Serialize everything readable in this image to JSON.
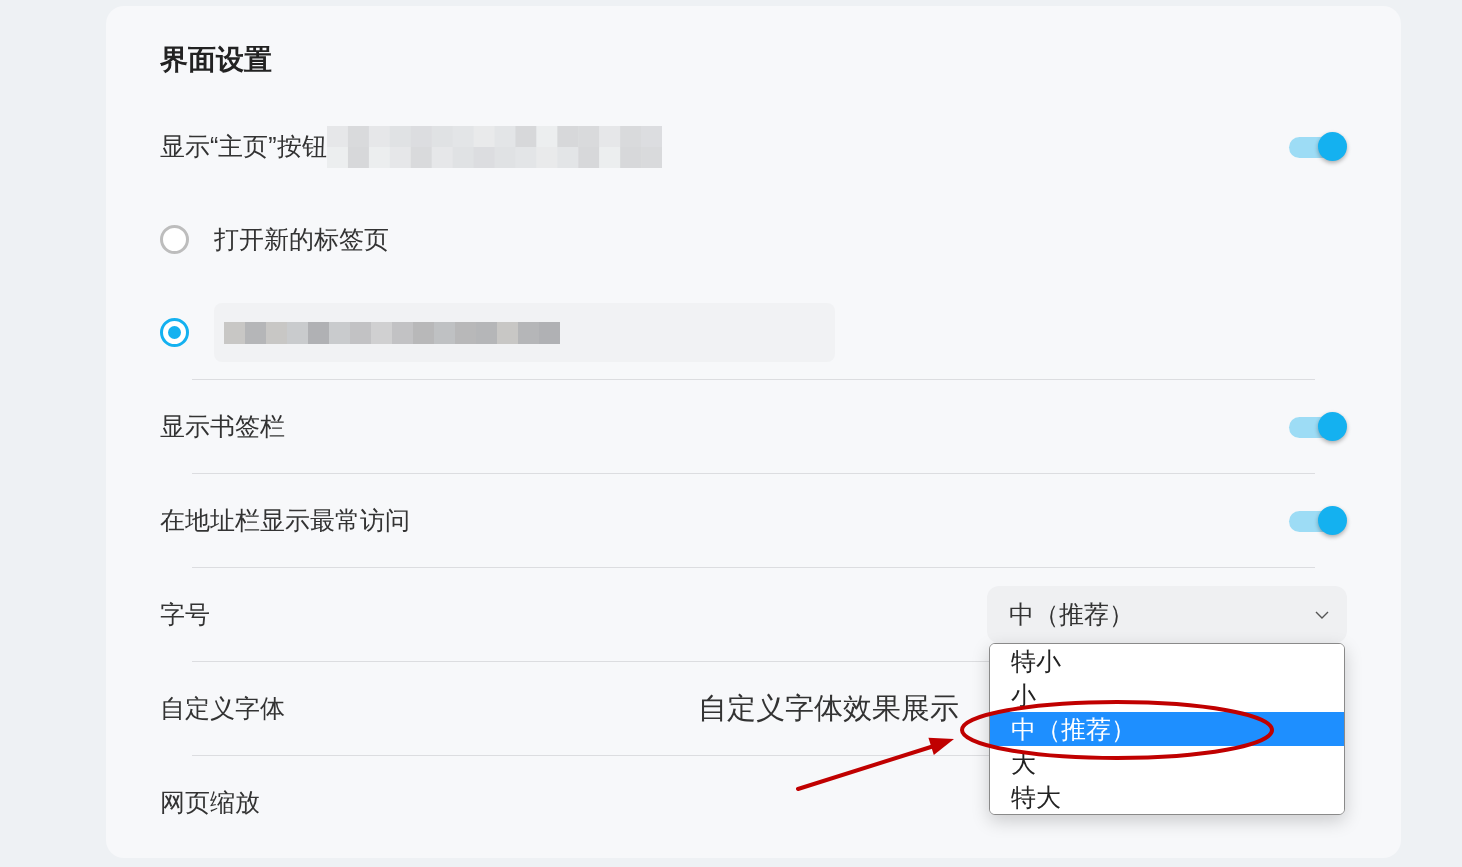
{
  "section_title": "界面设置",
  "settings": [
    {
      "kind": "toggle",
      "label": "显示“主页”按钮",
      "on": true,
      "redacted_suffix": true,
      "options": [
        {
          "kind": "text",
          "label": "打开新的标签页",
          "selected": false
        },
        {
          "kind": "field",
          "redacted_value": true,
          "selected": true
        }
      ]
    },
    {
      "kind": "toggle",
      "label": "显示书签栏",
      "on": true
    },
    {
      "kind": "toggle",
      "label": "在地址栏显示最常访问",
      "on": true
    },
    {
      "kind": "select",
      "label": "字号",
      "value": "中（推荐）",
      "expanded": true,
      "options": [
        {
          "label": "特小",
          "selected": false
        },
        {
          "label": "小",
          "selected": false
        },
        {
          "label": "中（推荐）",
          "selected": true,
          "circled": true,
          "arrow": true
        },
        {
          "label": "大",
          "selected": false
        },
        {
          "label": "特大",
          "selected": false
        }
      ]
    },
    {
      "kind": "preview",
      "label": "自定义字体",
      "preview": "自定义字体效果展示"
    },
    {
      "kind": "plain",
      "label": "网页缩放"
    }
  ]
}
